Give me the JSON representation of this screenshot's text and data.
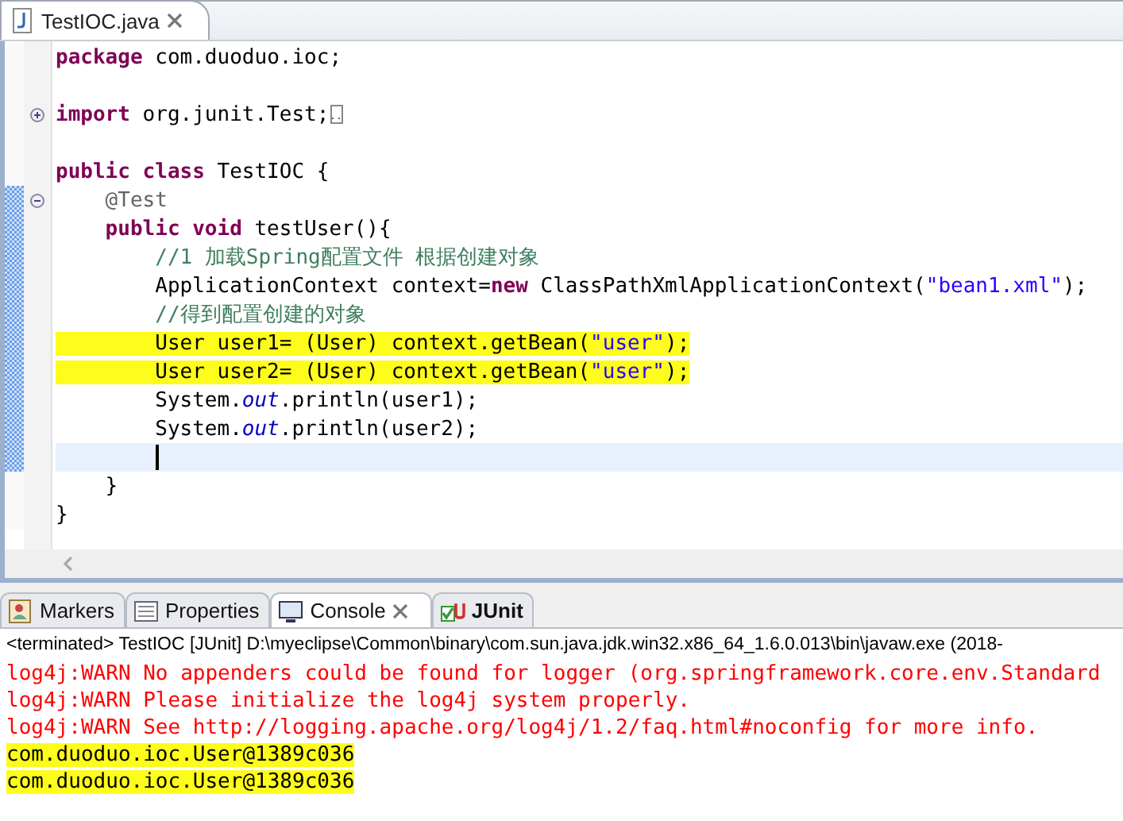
{
  "editor_tab": {
    "label": "TestIOC.java"
  },
  "code_lines": [
    {
      "changed": false,
      "current": false,
      "highlighted": false,
      "tokens": [
        {
          "kind": "keyword",
          "text": "package"
        },
        {
          "kind": "plain",
          "text": " com.duoduo.ioc;"
        }
      ]
    },
    {
      "changed": false,
      "current": false,
      "highlighted": false
    },
    {
      "changed": false,
      "current": false,
      "highlighted": false,
      "folded": true,
      "tokens": [
        {
          "kind": "keyword",
          "text": "import"
        },
        {
          "kind": "plain",
          "text": " org.junit.Test;"
        }
      ]
    },
    {
      "changed": false,
      "current": false,
      "highlighted": false
    },
    {
      "changed": false,
      "current": false,
      "highlighted": false,
      "tokens": [
        {
          "kind": "keyword",
          "text": "public class"
        },
        {
          "kind": "plain",
          "text": " TestIOC {"
        }
      ]
    },
    {
      "changed": true,
      "current": false,
      "highlighted": false,
      "folded": false,
      "tokens": [
        {
          "kind": "annotation",
          "text": "    @Test"
        }
      ]
    },
    {
      "changed": true,
      "current": false,
      "highlighted": false,
      "tokens": [
        {
          "kind": "keyword",
          "text": "    public void"
        },
        {
          "kind": "plain",
          "text": " testUser(){"
        }
      ]
    },
    {
      "changed": true,
      "current": false,
      "highlighted": false,
      "tokens": [
        {
          "kind": "comment",
          "text": "        //1 加载Spring配置文件 根据创建对象"
        }
      ]
    },
    {
      "changed": true,
      "current": false,
      "highlighted": false,
      "tokens": [
        {
          "kind": "plain",
          "text": "        ApplicationContext context="
        },
        {
          "kind": "keyword",
          "text": "new"
        },
        {
          "kind": "plain",
          "text": " ClassPathXmlApplicationContext("
        },
        {
          "kind": "string",
          "text": "\"bean1.xml\""
        },
        {
          "kind": "plain",
          "text": ");"
        }
      ]
    },
    {
      "changed": true,
      "current": false,
      "highlighted": false,
      "tokens": [
        {
          "kind": "comment",
          "text": "        //得到配置创建的对象"
        }
      ]
    },
    {
      "changed": true,
      "current": false,
      "highlighted": true,
      "tokens": [
        {
          "kind": "plain",
          "text": "        User user1= (User) context.getBean("
        },
        {
          "kind": "string",
          "text": "\"user\""
        },
        {
          "kind": "plain",
          "text": ");"
        }
      ]
    },
    {
      "changed": true,
      "current": false,
      "highlighted": true,
      "tokens": [
        {
          "kind": "plain",
          "text": "        User user2= (User) context.getBean("
        },
        {
          "kind": "string",
          "text": "\"user\""
        },
        {
          "kind": "plain",
          "text": ");"
        }
      ]
    },
    {
      "changed": true,
      "current": false,
      "highlighted": false,
      "tokens": [
        {
          "kind": "plain",
          "text": "        System."
        },
        {
          "kind": "static",
          "text": "out"
        },
        {
          "kind": "plain",
          "text": ".println(user1);"
        }
      ]
    },
    {
      "changed": true,
      "current": false,
      "highlighted": false,
      "tokens": [
        {
          "kind": "plain",
          "text": "        System."
        },
        {
          "kind": "static",
          "text": "out"
        },
        {
          "kind": "plain",
          "text": ".println(user2);"
        }
      ]
    },
    {
      "changed": true,
      "current": true,
      "highlighted": false
    },
    {
      "changed": false,
      "current": false,
      "highlighted": false,
      "tokens": [
        {
          "kind": "plain",
          "text": "    }"
        }
      ]
    },
    {
      "changed": false,
      "current": false,
      "highlighted": false,
      "tokens": [
        {
          "kind": "plain",
          "text": "}"
        }
      ]
    }
  ],
  "panel_tabs": [
    {
      "kind": "markers",
      "label": "Markers",
      "selected": false
    },
    {
      "kind": "properties",
      "label": "Properties",
      "selected": false
    },
    {
      "kind": "console",
      "label": "Console",
      "selected": true
    },
    {
      "kind": "junit",
      "label": "JUnit",
      "selected": false
    }
  ],
  "console": {
    "header": "<terminated> TestIOC [JUnit] D:\\myeclipse\\Common\\binary\\com.sun.java.jdk.win32.x86_64_1.6.0.013\\bin\\javaw.exe (2018-",
    "lines": [
      {
        "kind": "error",
        "highlighted": false,
        "text": "log4j:WARN No appenders could be found for logger (org.springframework.core.env.Standard"
      },
      {
        "kind": "error",
        "highlighted": false,
        "text": "log4j:WARN Please initialize the log4j system properly."
      },
      {
        "kind": "error",
        "highlighted": false,
        "text": "log4j:WARN See http://logging.apache.org/log4j/1.2/faq.html#noconfig for more info."
      },
      {
        "kind": "output",
        "highlighted": true,
        "text": "com.duoduo.ioc.User@1389c036"
      },
      {
        "kind": "output",
        "highlighted": true,
        "text": "com.duoduo.ioc.User@1389c036"
      }
    ]
  }
}
